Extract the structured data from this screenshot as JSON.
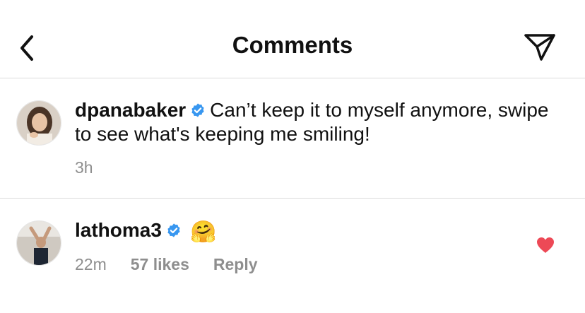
{
  "header": {
    "title": "Comments",
    "back_icon": "chevron-left-icon",
    "send_icon": "paper-plane-icon"
  },
  "caption": {
    "username": "dpanabaker",
    "verified": true,
    "text": "Can’t keep it to myself anymore, swipe to see what's keeping me smiling!",
    "time": "3h"
  },
  "comment": {
    "username": "lathoma3",
    "verified": true,
    "text": "🤗",
    "time": "22m",
    "likes": "57 likes",
    "reply_label": "Reply",
    "liked": true
  },
  "colors": {
    "verified_blue": "#3897f0",
    "like_red": "#ed4956",
    "meta_gray": "#8e8e8e",
    "divider": "#dbdbdb"
  }
}
